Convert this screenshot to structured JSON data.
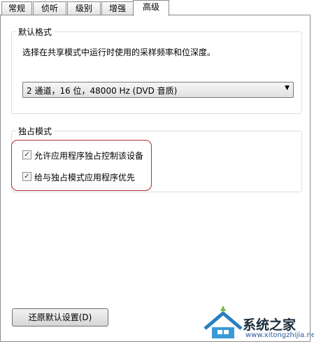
{
  "tabs": [
    {
      "label": "常规"
    },
    {
      "label": "侦听"
    },
    {
      "label": "级别"
    },
    {
      "label": "增强"
    },
    {
      "label": "高级"
    }
  ],
  "default_format": {
    "legend": "默认格式",
    "description": "选择在共享模式中运行时使用的采样频率和位深度。",
    "selected": "2 通道，16 位，48000 Hz (DVD 音质)"
  },
  "exclusive_mode": {
    "legend": "独占模式",
    "options": [
      {
        "label": "允许应用程序独占控制该设备",
        "checked": true
      },
      {
        "label": "给与独占模式应用程序优先",
        "checked": true
      }
    ]
  },
  "restore_button": "还原默认设置(D)",
  "watermark": {
    "text": "系统之家",
    "url": "www.xitongzhijia.net"
  },
  "colors": {
    "highlight": "#b03030",
    "group_border": "#d5dfe5"
  }
}
